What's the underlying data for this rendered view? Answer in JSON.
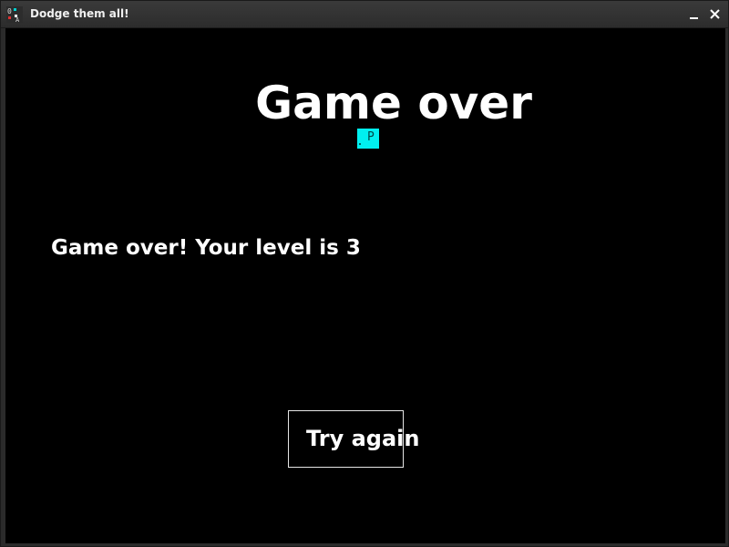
{
  "window": {
    "title": "Dodge them all!",
    "icon": "game-app-icon"
  },
  "controls": {
    "minimize_icon": "minimize-icon",
    "close_icon": "close-icon"
  },
  "game": {
    "heading": "Game over",
    "player_glyph": "P",
    "message": "Game over! Your level is 3",
    "level": 3,
    "try_again_label": "Try again",
    "colors": {
      "background": "#000000",
      "text": "#ffffff",
      "player": "#00f0f0"
    }
  }
}
